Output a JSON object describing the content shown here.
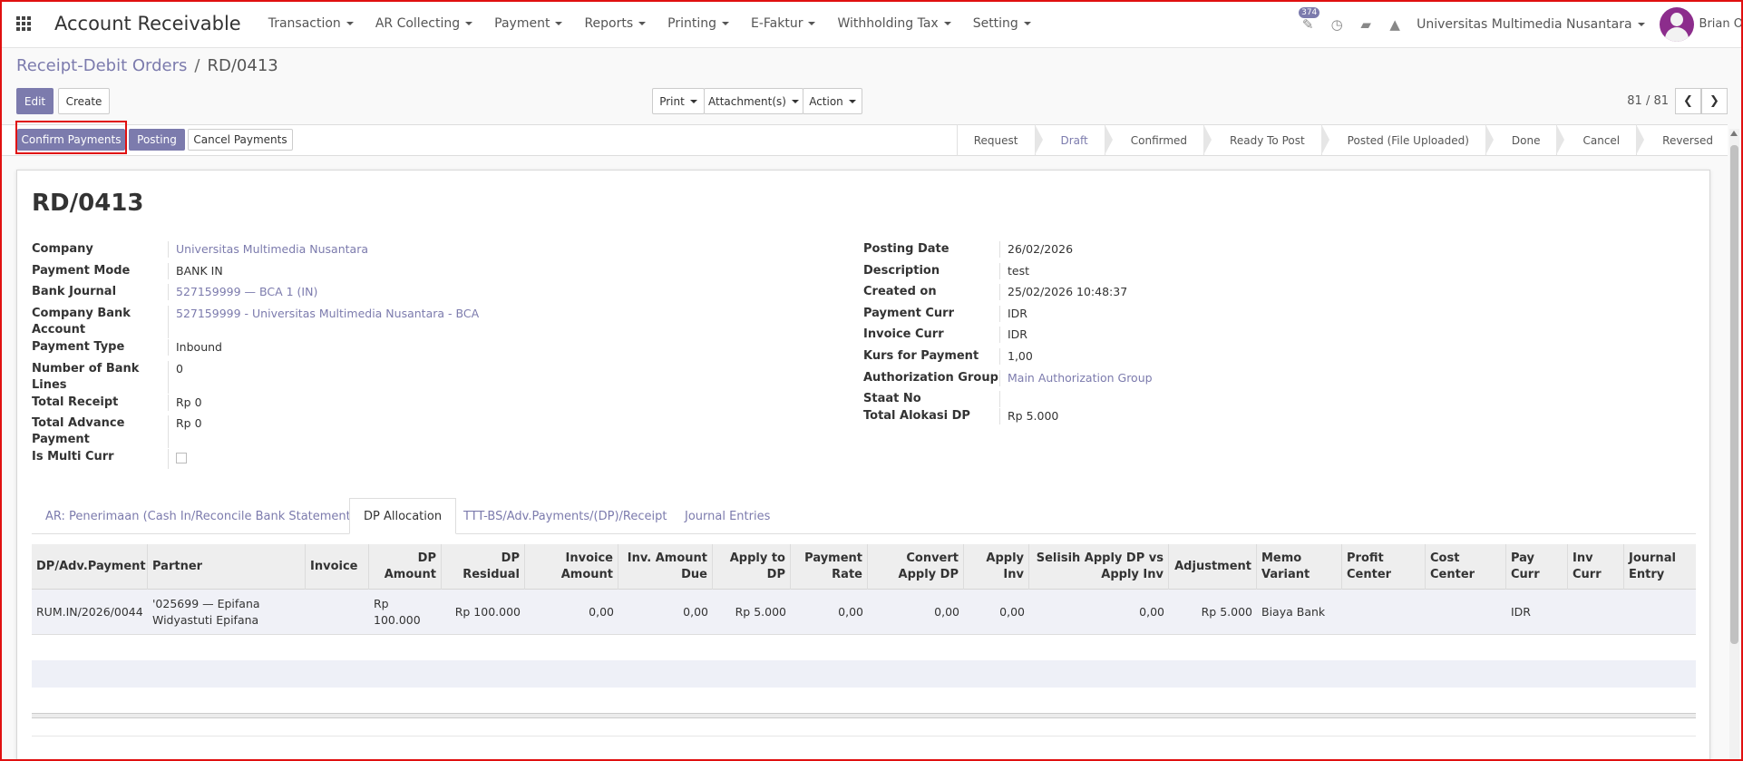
{
  "navbar": {
    "app_title": "Account Receivable",
    "menu": [
      "Transaction",
      "AR Collecting",
      "Payment",
      "Reports",
      "Printing",
      "E-Faktur",
      "Withholding Tax",
      "Setting"
    ],
    "activity_count": "374",
    "company": "Universitas Multimedia Nusantara",
    "user": "Brian O"
  },
  "breadcrumb": {
    "parent": "Receipt-Debit Orders",
    "separator": "/",
    "current": "RD/0413"
  },
  "buttons": {
    "edit": "Edit",
    "create": "Create",
    "print": "Print",
    "attachments": "Attachment(s)",
    "action": "Action",
    "confirm_payments": "Confirm Payments",
    "posting": "Posting",
    "cancel_payments": "Cancel Payments"
  },
  "pager": {
    "value": "81 / 81"
  },
  "stages": [
    "Request",
    "Draft",
    "Confirmed",
    "Ready To Post",
    "Posted (File Uploaded)",
    "Done",
    "Cancel",
    "Reversed"
  ],
  "active_stage": "Draft",
  "record": {
    "title": "RD/0413",
    "left": [
      {
        "label": "Company",
        "value": "Universitas Multimedia Nusantara"
      },
      {
        "label": "Payment Mode",
        "value": "BANK IN"
      },
      {
        "label": "Bank Journal",
        "value": "527159999 — BCA 1 (IN)"
      },
      {
        "label": "Company Bank Account",
        "value": "527159999 - Universitas Multimedia Nusantara - BCA"
      },
      {
        "label": "Payment Type",
        "value": "Inbound"
      },
      {
        "label": "Number of Bank Lines",
        "value": "0"
      },
      {
        "label": "Total Receipt",
        "value": "Rp 0"
      },
      {
        "label": "Total Advance Payment",
        "value": "Rp 0"
      },
      {
        "label": "Is Multi Curr",
        "value": ""
      }
    ],
    "right": [
      {
        "label": "Posting Date",
        "value": "26/02/2026"
      },
      {
        "label": "Description",
        "value": "test"
      },
      {
        "label": "Created on",
        "value": "25/02/2026 10:48:37"
      },
      {
        "label": "Payment Curr",
        "value": "IDR"
      },
      {
        "label": "Invoice Curr",
        "value": "IDR"
      },
      {
        "label": "Kurs for Payment",
        "value": "1,00"
      },
      {
        "label": "Authorization Group",
        "value": "Main Authorization Group"
      },
      {
        "label": "Staat No",
        "value": ""
      },
      {
        "label": "Total Alokasi DP",
        "value": "Rp 5.000"
      }
    ]
  },
  "tabs": [
    "AR: Penerimaan (Cash In/Reconcile Bank Statements)",
    "DP Allocation",
    "TTT-BS/Adv.Payments/(DP)/Receipt",
    "Journal Entries"
  ],
  "table": {
    "columns": [
      "DP/Adv.Payment",
      "Partner",
      "Invoice",
      "DP Amount",
      "DP Residual",
      "Invoice Amount",
      "Inv. Amount Due",
      "Apply to DP",
      "Payment Rate",
      "Convert Apply DP",
      "Apply Inv",
      "Selisih Apply DP vs Apply Inv",
      "Adjustment",
      "Memo Variant",
      "Profit Center",
      "Cost Center",
      "Pay Curr",
      "Inv Curr",
      "Journal Entry"
    ],
    "rows": [
      [
        "RUM.IN/2026/0044",
        "'025699 — Epifana Widyastuti Epifana",
        "",
        "Rp 100.000",
        "Rp 100.000",
        "0,00",
        "0,00",
        "Rp 5.000",
        "0,00",
        "0,00",
        "0,00",
        "0,00",
        "Rp 5.000",
        "Biaya Bank",
        "",
        "",
        "IDR",
        "",
        ""
      ]
    ]
  }
}
